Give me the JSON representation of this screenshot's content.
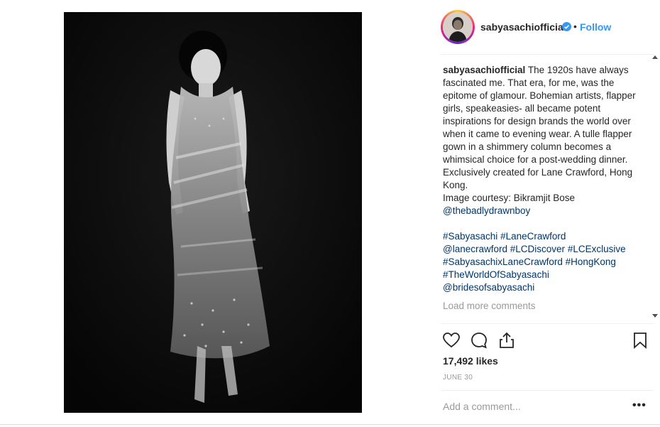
{
  "post": {
    "username": "sabyasachiofficial",
    "follow_separator": "•",
    "follow_label": "Follow",
    "image_alt": "Model in sheer embellished flapper gown, black and white"
  },
  "caption": {
    "username": "sabyasachiofficial",
    "text": " The 1920s have always fascinated me. That era, for me, was the epitome of glamour. Bohemian artists, flapper girls, speakeasies- all became potent inspirations for design brands the world over when it came to evening wear. A tulle flapper gown in a shimmery column becomes a whimsical choice for a post-wedding dinner.",
    "line2": "Exclusively created for Lane Crawford, Hong Kong.",
    "line3": "Image courtesy: Bikramjit Bose",
    "mention_credit": "@thebadlydrawnboy",
    "tags": {
      "t1": "#Sabyasachi",
      "t2": "#LaneCrawford",
      "t3": "@lanecrawford",
      "t4": "#LCDiscover",
      "t5": "#LCExclusive",
      "t6": "#SabyasachixLaneCrawford",
      "t7": "#HongKong",
      "t8": "#TheWorldOfSabyasachi",
      "t9": "@bridesofsabyasachi"
    },
    "load_more": "Load more comments"
  },
  "actions": {
    "like_icon": "heart-icon",
    "comment_icon": "comment-icon",
    "share_icon": "share-icon",
    "save_icon": "bookmark-icon"
  },
  "likes": "17,492 likes",
  "date": "JUNE 30",
  "comment_box": {
    "placeholder": "Add a comment...",
    "more_label": "•••"
  },
  "colors": {
    "accent": "#3897f0",
    "link": "#003569",
    "muted": "#999999",
    "text": "#262626"
  }
}
